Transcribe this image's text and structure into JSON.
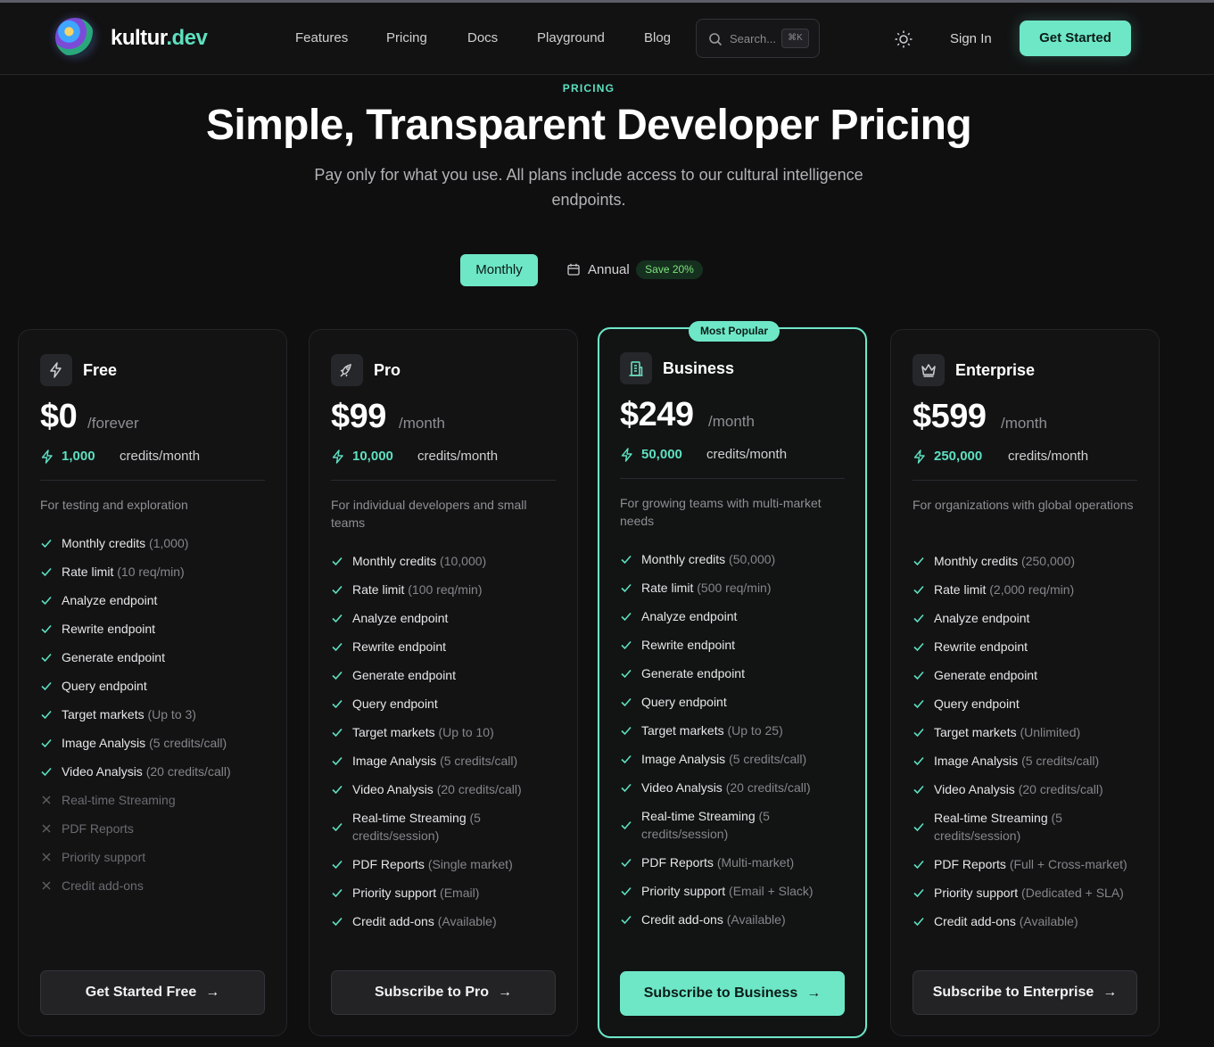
{
  "brand": {
    "part1": "kultur",
    "part2": ".dev"
  },
  "nav": [
    "Features",
    "Pricing",
    "Docs",
    "Playground",
    "Blog"
  ],
  "search": {
    "placeholder": "Search...",
    "shortcut": "⌘K"
  },
  "header": {
    "signin": "Sign In",
    "cta": "Get Started"
  },
  "hero": {
    "eyebrow": "PRICING",
    "title": "Simple, Transparent Developer Pricing",
    "subtitle": "Pay only for what you use. All plans include access to our cultural intelligence endpoints."
  },
  "billing": {
    "monthly": "Monthly",
    "annual": "Annual",
    "save": "Save 20%",
    "selected": "Monthly"
  },
  "popular_badge": "Most Popular",
  "colors": {
    "accent": "#6ee7c7",
    "background": "#0f0f10",
    "card": "#131314",
    "save_green": "#7de37a"
  },
  "plans": [
    {
      "name": "Free",
      "icon": "zap-icon",
      "price": "$0",
      "period": "/forever",
      "credits_num": "1,000",
      "credits_unit": "credits/month",
      "description": "For testing and exploration",
      "features": [
        {
          "name": "Monthly credits",
          "detail": "(1,000)",
          "included": true
        },
        {
          "name": "Rate limit",
          "detail": "(10 req/min)",
          "included": true
        },
        {
          "name": "Analyze endpoint",
          "detail": "",
          "included": true
        },
        {
          "name": "Rewrite endpoint",
          "detail": "",
          "included": true
        },
        {
          "name": "Generate endpoint",
          "detail": "",
          "included": true
        },
        {
          "name": "Query endpoint",
          "detail": "",
          "included": true
        },
        {
          "name": "Target markets",
          "detail": "(Up to 3)",
          "included": true
        },
        {
          "name": "Image Analysis",
          "detail": "(5 credits/call)",
          "included": true
        },
        {
          "name": "Video Analysis",
          "detail": "(20 credits/call)",
          "included": true
        },
        {
          "name": "Real-time Streaming",
          "detail": "",
          "included": false
        },
        {
          "name": "PDF Reports",
          "detail": "",
          "included": false
        },
        {
          "name": "Priority support",
          "detail": "",
          "included": false
        },
        {
          "name": "Credit add-ons",
          "detail": "",
          "included": false
        }
      ],
      "cta": "Get Started Free"
    },
    {
      "name": "Pro",
      "icon": "rocket-icon",
      "price": "$99",
      "period": "/month",
      "credits_num": "10,000",
      "credits_unit": "credits/month",
      "description": "For individual developers and small teams",
      "features": [
        {
          "name": "Monthly credits",
          "detail": "(10,000)",
          "included": true
        },
        {
          "name": "Rate limit",
          "detail": "(100 req/min)",
          "included": true
        },
        {
          "name": "Analyze endpoint",
          "detail": "",
          "included": true
        },
        {
          "name": "Rewrite endpoint",
          "detail": "",
          "included": true
        },
        {
          "name": "Generate endpoint",
          "detail": "",
          "included": true
        },
        {
          "name": "Query endpoint",
          "detail": "",
          "included": true
        },
        {
          "name": "Target markets",
          "detail": "(Up to 10)",
          "included": true
        },
        {
          "name": "Image Analysis",
          "detail": "(5 credits/call)",
          "included": true
        },
        {
          "name": "Video Analysis",
          "detail": "(20 credits/call)",
          "included": true
        },
        {
          "name": "Real-time Streaming",
          "detail": "(5 credits/session)",
          "included": true
        },
        {
          "name": "PDF Reports",
          "detail": "(Single market)",
          "included": true
        },
        {
          "name": "Priority support",
          "detail": "(Email)",
          "included": true
        },
        {
          "name": "Credit add-ons",
          "detail": "(Available)",
          "included": true
        }
      ],
      "cta": "Subscribe to Pro"
    },
    {
      "name": "Business",
      "icon": "building-icon",
      "price": "$249",
      "period": "/month",
      "credits_num": "50,000",
      "credits_unit": "credits/month",
      "description": "For growing teams with multi-market needs",
      "features": [
        {
          "name": "Monthly credits",
          "detail": "(50,000)",
          "included": true
        },
        {
          "name": "Rate limit",
          "detail": "(500 req/min)",
          "included": true
        },
        {
          "name": "Analyze endpoint",
          "detail": "",
          "included": true
        },
        {
          "name": "Rewrite endpoint",
          "detail": "",
          "included": true
        },
        {
          "name": "Generate endpoint",
          "detail": "",
          "included": true
        },
        {
          "name": "Query endpoint",
          "detail": "",
          "included": true
        },
        {
          "name": "Target markets",
          "detail": "(Up to 25)",
          "included": true
        },
        {
          "name": "Image Analysis",
          "detail": "(5 credits/call)",
          "included": true
        },
        {
          "name": "Video Analysis",
          "detail": "(20 credits/call)",
          "included": true
        },
        {
          "name": "Real-time Streaming",
          "detail": "(5 credits/session)",
          "included": true
        },
        {
          "name": "PDF Reports",
          "detail": "(Multi-market)",
          "included": true
        },
        {
          "name": "Priority support",
          "detail": "(Email + Slack)",
          "included": true
        },
        {
          "name": "Credit add-ons",
          "detail": "(Available)",
          "included": true
        }
      ],
      "cta": "Subscribe to Business"
    },
    {
      "name": "Enterprise",
      "icon": "crown-icon",
      "price": "$599",
      "period": "/month",
      "credits_num": "250,000",
      "credits_unit": "credits/month",
      "description": "For organizations with global operations",
      "features": [
        {
          "name": "Monthly credits",
          "detail": "(250,000)",
          "included": true
        },
        {
          "name": "Rate limit",
          "detail": "(2,000 req/min)",
          "included": true
        },
        {
          "name": "Analyze endpoint",
          "detail": "",
          "included": true
        },
        {
          "name": "Rewrite endpoint",
          "detail": "",
          "included": true
        },
        {
          "name": "Generate endpoint",
          "detail": "",
          "included": true
        },
        {
          "name": "Query endpoint",
          "detail": "",
          "included": true
        },
        {
          "name": "Target markets",
          "detail": "(Unlimited)",
          "included": true
        },
        {
          "name": "Image Analysis",
          "detail": "(5 credits/call)",
          "included": true
        },
        {
          "name": "Video Analysis",
          "detail": "(20 credits/call)",
          "included": true
        },
        {
          "name": "Real-time Streaming",
          "detail": "(5 credits/session)",
          "included": true
        },
        {
          "name": "PDF Reports",
          "detail": "(Full + Cross-market)",
          "included": true
        },
        {
          "name": "Priority support",
          "detail": "(Dedicated + SLA)",
          "included": true
        },
        {
          "name": "Credit add-ons",
          "detail": "(Available)",
          "included": true
        }
      ],
      "cta": "Subscribe to Enterprise"
    }
  ]
}
